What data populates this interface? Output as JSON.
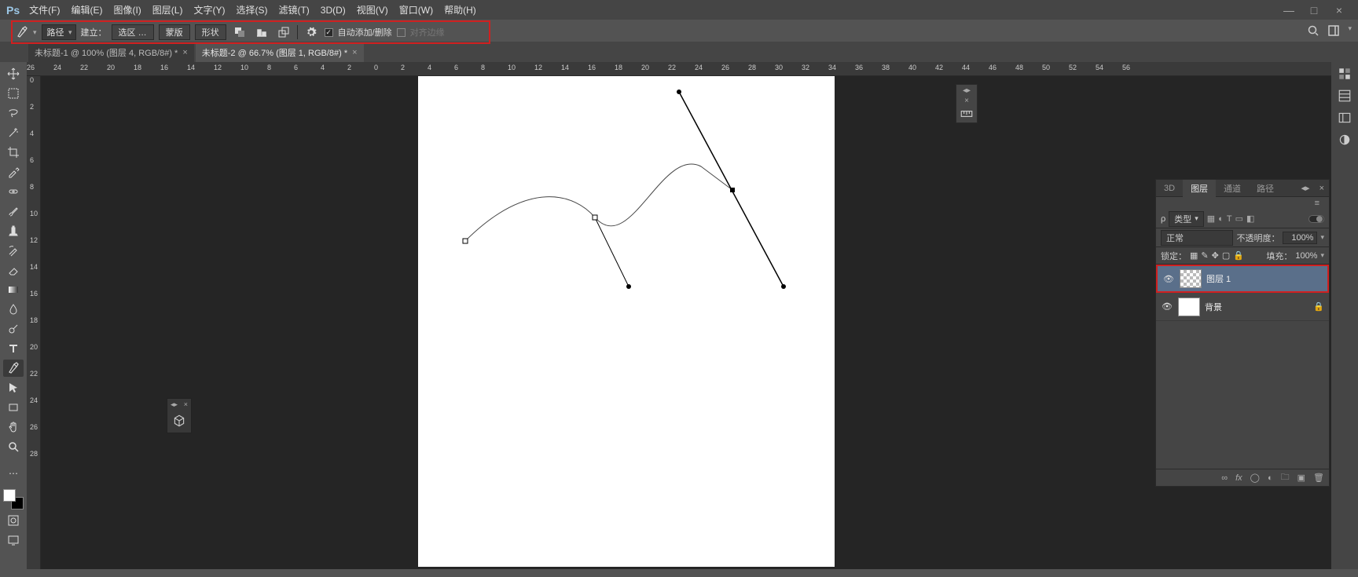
{
  "app_logo": "Ps",
  "menu": [
    "文件(F)",
    "编辑(E)",
    "图像(I)",
    "图层(L)",
    "文字(Y)",
    "选择(S)",
    "滤镜(T)",
    "3D(D)",
    "视图(V)",
    "窗口(W)",
    "帮助(H)"
  ],
  "window_controls": {
    "minimize": "—",
    "maximize": "□",
    "close": "×"
  },
  "options_bar": {
    "mode_label": "路径",
    "build_label": "建立：",
    "selection_btn": "选区 …",
    "mask_btn": "蒙版",
    "shape_btn": "形状",
    "auto_label": "自动添加/删除",
    "align_edges": "对齐边缘"
  },
  "tabs": [
    {
      "title": "未标题-1 @ 100% (图层 4, RGB/8#) *",
      "active": false
    },
    {
      "title": "未标题-2 @ 66.7% (图层 1, RGB/8#) *",
      "active": true
    }
  ],
  "ruler_h": [
    "26",
    "24",
    "22",
    "20",
    "18",
    "16",
    "14",
    "12",
    "10",
    "8",
    "6",
    "4",
    "2",
    "0",
    "2",
    "4",
    "6",
    "8",
    "10",
    "12",
    "14",
    "16",
    "18",
    "20",
    "22",
    "24",
    "26",
    "28",
    "30",
    "32",
    "34",
    "36",
    "38",
    "40",
    "42",
    "44",
    "46",
    "48",
    "50",
    "52",
    "54",
    "56"
  ],
  "ruler_v": [
    "0",
    "2",
    "4",
    "6",
    "8",
    "10",
    "12",
    "14",
    "16",
    "18",
    "20",
    "22",
    "24",
    "26",
    "28"
  ],
  "panel": {
    "tabs": [
      "3D",
      "图层",
      "通道",
      "路径"
    ],
    "active_tab": "图层",
    "filter_label": "类型",
    "blend_mode": "正常",
    "opacity_label": "不透明度：",
    "opacity_value": "100%",
    "lock_label": "锁定：",
    "fill_label": "填充：",
    "fill_value": "100%",
    "layers": [
      {
        "name": "图层 1",
        "selected": true,
        "highlight": true,
        "locked": false,
        "checker": true
      },
      {
        "name": "背景",
        "selected": false,
        "highlight": false,
        "locked": true,
        "checker": false
      }
    ],
    "footer_link": "∞"
  }
}
